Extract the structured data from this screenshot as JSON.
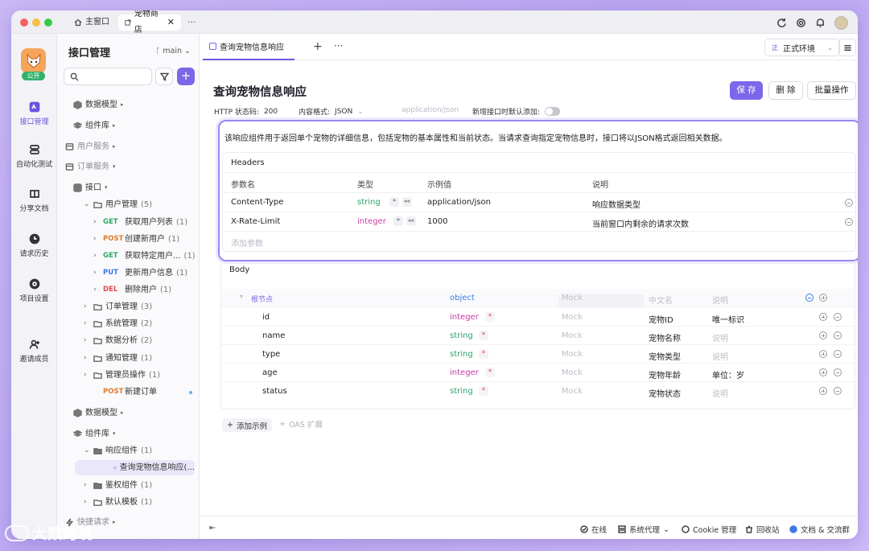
{
  "window_tabs": [
    {
      "label": "主窗口"
    },
    {
      "label": "宠物商店"
    }
  ],
  "rail": {
    "public_badge": "公开",
    "items": [
      {
        "label": "接口管理"
      },
      {
        "label": "自动化测试"
      },
      {
        "label": "分享文档"
      },
      {
        "label": "请求历史"
      },
      {
        "label": "项目设置"
      },
      {
        "label": "邀请成员"
      }
    ]
  },
  "tree": {
    "title": "接口管理",
    "branch": "main",
    "nodes": [
      {
        "label": "数据模型"
      },
      {
        "label": "组件库"
      },
      {
        "label": "用户服务"
      },
      {
        "label": "订单服务"
      },
      {
        "label": "接口"
      },
      {
        "label": "用户管理",
        "count": "(5)"
      },
      {
        "method": "GET",
        "label": "获取用户列表",
        "count": "(1)"
      },
      {
        "method": "POST",
        "label": "创建新用户",
        "count": "(1)"
      },
      {
        "method": "GET",
        "label": "获取特定用户...",
        "count": "(1)"
      },
      {
        "method": "PUT",
        "label": "更新用户信息",
        "count": "(1)"
      },
      {
        "method": "DEL",
        "label": "删除用户",
        "count": "(1)"
      },
      {
        "label": "订单管理",
        "count": "(3)"
      },
      {
        "label": "系统管理",
        "count": "(2)"
      },
      {
        "label": "数据分析",
        "count": "(2)"
      },
      {
        "label": "通知管理",
        "count": "(1)"
      },
      {
        "label": "管理员操作",
        "count": "(1)"
      },
      {
        "method": "POST",
        "label": "新建订单"
      },
      {
        "label": "数据模型"
      },
      {
        "label": "组件库"
      },
      {
        "label": "响应组件",
        "count": "(1)"
      },
      {
        "label": "查询宠物信息响应(..."
      },
      {
        "label": "鉴权组件",
        "count": "(1)"
      },
      {
        "label": "默认模板",
        "count": "(1)"
      },
      {
        "label": "快捷请求"
      }
    ]
  },
  "main": {
    "doc_tab": "查询宠物信息响应",
    "env": "正式环境",
    "env_mark": "正",
    "title": "查询宠物信息响应",
    "buttons": {
      "save": "保 存",
      "delete": "删 除",
      "bulk": "批量操作"
    },
    "meta": {
      "status_label": "HTTP 状态码:",
      "status_value": "200",
      "content_label": "内容格式:",
      "content_value": "JSON",
      "content_placeholder": "application/json",
      "default_add_label": "新增接口时默认添加:"
    },
    "description": "该响应组件用于返回单个宠物的详细信息，包括宠物的基本属性和当前状态。当请求查询指定宠物信息时，接口将以JSON格式返回相关数据。",
    "headers": {
      "title": "Headers",
      "columns": [
        "参数名",
        "类型",
        "示例值",
        "说明"
      ],
      "rows": [
        {
          "name": "Content-Type",
          "type": "string",
          "example": "application/json",
          "desc": "响应数据类型"
        },
        {
          "name": "X-Rate-Limit",
          "type": "integer",
          "example": "1000",
          "desc": "当前窗口内剩余的请求次数"
        }
      ],
      "add_placeholder": "添加参数"
    },
    "body": {
      "title": "Body",
      "root": {
        "label": "根节点",
        "type": "object",
        "mock": "Mock",
        "cn_name": "中文名",
        "desc": "说明"
      },
      "fields": [
        {
          "name": "id",
          "type": "integer",
          "mock": "Mock",
          "cn": "宠物ID",
          "desc": "唯一标识"
        },
        {
          "name": "name",
          "type": "string",
          "mock": "Mock",
          "cn": "宠物名称",
          "desc": "说明"
        },
        {
          "name": "type",
          "type": "string",
          "mock": "Mock",
          "cn": "宠物类型",
          "desc": "说明"
        },
        {
          "name": "age",
          "type": "integer",
          "mock": "Mock",
          "cn": "宠物年龄",
          "desc": "单位：岁"
        },
        {
          "name": "status",
          "type": "string",
          "mock": "Mock",
          "cn": "宠物状态",
          "desc": "说明"
        }
      ]
    },
    "add_example": "添加示例",
    "oas_ext": "OAS 扩展"
  },
  "statusbar": {
    "online": "在线",
    "proxy": "系统代理",
    "cookie": "Cookie 管理",
    "trash": "回收站",
    "docs": "文档 & 交流群"
  },
  "watermark": "大数跨境",
  "colors": {
    "accent": "#7d66ea",
    "get": "#28a964",
    "post": "#e2792b",
    "put": "#3c79e6",
    "del": "#e24a4a",
    "string_type": "#2ea169",
    "integer_type": "#c63aa8"
  }
}
